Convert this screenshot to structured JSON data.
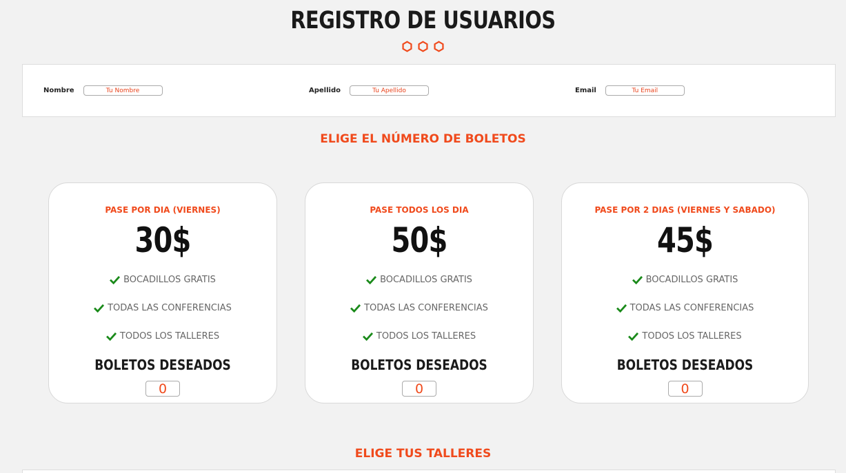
{
  "header": {
    "title": "REGISTRO DE USUARIOS",
    "accent_color": "#f04a1c"
  },
  "form": {
    "fields": [
      {
        "label": "Nombre",
        "placeholder": "Tu Nombre"
      },
      {
        "label": "Apellido",
        "placeholder": "Tu Apellido"
      },
      {
        "label": "Email",
        "placeholder": "Tu Email"
      }
    ]
  },
  "tickets": {
    "heading": "ELIGE EL NÚMERO DE BOLETOS",
    "cards": [
      {
        "title": "PASE POR DIA (VIERNES)",
        "price": "30$",
        "features": [
          "BOCADILLOS GRATIS",
          "TODAS LAS CONFERENCIAS",
          "TODOS LOS TALLERES"
        ],
        "wanted_label": "BOLETOS DESEADOS",
        "quantity": "0"
      },
      {
        "title": "PASE TODOS LOS DIA",
        "price": "50$",
        "features": [
          "BOCADILLOS GRATIS",
          "TODAS LAS CONFERENCIAS",
          "TODOS LOS TALLERES"
        ],
        "wanted_label": "BOLETOS DESEADOS",
        "quantity": "0"
      },
      {
        "title": "PASE POR 2 DIAS (VIERNES Y SABADO)",
        "price": "45$",
        "features": [
          "BOCADILLOS GRATIS",
          "TODAS LAS CONFERENCIAS",
          "TODOS LOS TALLERES"
        ],
        "wanted_label": "BOLETOS DESEADOS",
        "quantity": "0"
      }
    ],
    "check_color": "#1a8a1a"
  },
  "workshops": {
    "heading": "ELIGE TUS TALLERES"
  }
}
